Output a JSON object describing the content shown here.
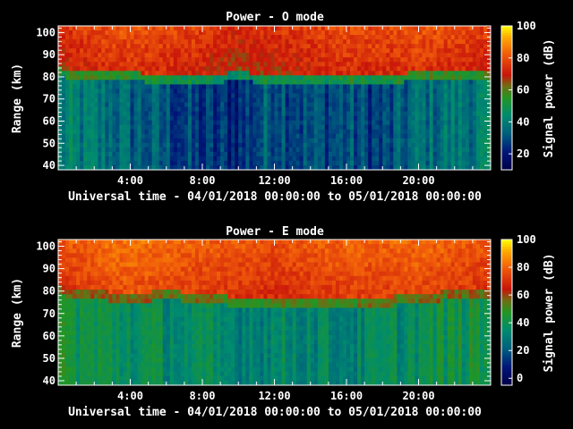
{
  "chart_data": [
    {
      "type": "heatmap",
      "title": "Power - O mode",
      "xlabel": "Universal time - 04/01/2018 00:00:00 to 05/01/2018 00:00:00",
      "ylabel": "Range (km)",
      "x_ticks": [
        "4:00",
        "8:00",
        "12:00",
        "16:00",
        "20:00"
      ],
      "y_ticks": [
        "40",
        "50",
        "60",
        "70",
        "80",
        "90",
        "100"
      ],
      "xlim": [
        0,
        24
      ],
      "ylim": [
        38,
        103
      ],
      "colorbar": {
        "label": "Signal power (dB)",
        "ticks": [
          "20",
          "40",
          "60",
          "80",
          "100"
        ],
        "range": [
          10,
          100
        ]
      },
      "profile": {
        "note_hours": [
          0,
          2,
          4,
          6,
          8,
          10,
          12,
          14,
          16,
          18,
          20,
          22,
          24
        ],
        "boundary_km": [
          82,
          80,
          80,
          79,
          79,
          80,
          79,
          79,
          78,
          79,
          80,
          80,
          80
        ],
        "upper_db": [
          68,
          72,
          74,
          72,
          70,
          66,
          68,
          70,
          72,
          72,
          74,
          72,
          70
        ],
        "lower_db": [
          40,
          38,
          34,
          30,
          24,
          24,
          34,
          28,
          30,
          26,
          36,
          38,
          40
        ]
      }
    },
    {
      "type": "heatmap",
      "title": "Power - E mode",
      "xlabel": "Universal time - 04/01/2018 00:00:00 to 05/01/2018 00:00:00",
      "ylabel": "Range (km)",
      "x_ticks": [
        "4:00",
        "8:00",
        "12:00",
        "16:00",
        "20:00"
      ],
      "y_ticks": [
        "40",
        "50",
        "60",
        "70",
        "80",
        "90",
        "100"
      ],
      "xlim": [
        0,
        24
      ],
      "ylim": [
        38,
        103
      ],
      "colorbar": {
        "label": "Signal power (dB)",
        "ticks": [
          "0",
          "20",
          "40",
          "60",
          "80",
          "100"
        ],
        "range": [
          -5,
          100
        ]
      },
      "profile": {
        "note_hours": [
          0,
          2,
          4,
          6,
          8,
          10,
          12,
          14,
          16,
          18,
          20,
          22,
          24
        ],
        "boundary_km": [
          80,
          78,
          77,
          78,
          77,
          75,
          74,
          74,
          74,
          75,
          77,
          78,
          78
        ],
        "upper_db": [
          70,
          74,
          76,
          74,
          72,
          70,
          68,
          70,
          72,
          72,
          74,
          72,
          70
        ],
        "lower_db": [
          44,
          40,
          38,
          36,
          34,
          32,
          34,
          34,
          32,
          34,
          38,
          40,
          42
        ]
      }
    }
  ]
}
